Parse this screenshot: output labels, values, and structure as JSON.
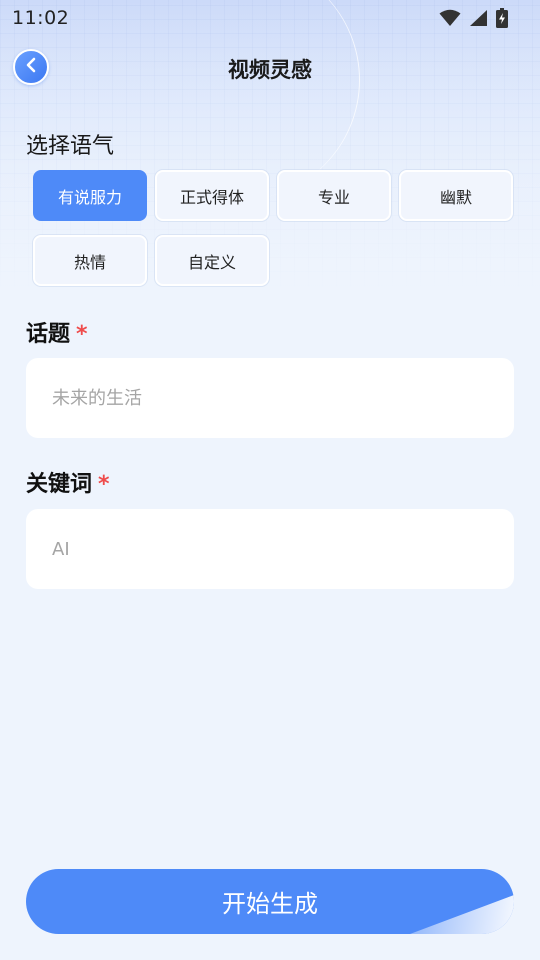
{
  "status_bar": {
    "time": "11:02"
  },
  "header": {
    "title": "视频灵感"
  },
  "tone": {
    "label": "选择语气",
    "options": [
      {
        "label": "有说服力",
        "selected": true
      },
      {
        "label": "正式得体",
        "selected": false
      },
      {
        "label": "专业",
        "selected": false
      },
      {
        "label": "幽默",
        "selected": false
      },
      {
        "label": "热情",
        "selected": false
      },
      {
        "label": "自定义",
        "selected": false
      }
    ]
  },
  "topic": {
    "label": "话题",
    "required_mark": "*",
    "placeholder": "未来的生活",
    "value": ""
  },
  "keywords": {
    "label": "关键词",
    "required_mark": "*",
    "placeholder": "AI",
    "value": ""
  },
  "action": {
    "generate_label": "开始生成"
  },
  "colors": {
    "accent": "#4e8af8",
    "required": "#ef4b4b",
    "background": "#eef4fd"
  }
}
